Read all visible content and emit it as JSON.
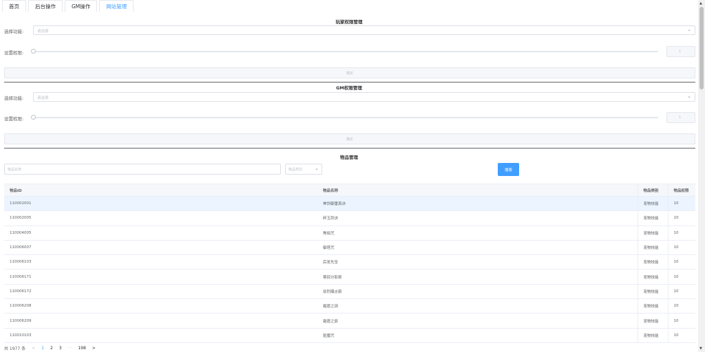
{
  "tabs": [
    {
      "label": "首页",
      "active": false
    },
    {
      "label": "后台操作",
      "active": false
    },
    {
      "label": "GM操作",
      "active": false
    },
    {
      "label": "网站管理",
      "active": true
    }
  ],
  "player_permission": {
    "title": "玩家权限管理",
    "function_label": "选择功能:",
    "function_placeholder": "请选择",
    "permission_label": "设置权限:",
    "permission_value": "1",
    "confirm_label": "确定"
  },
  "gm_permission": {
    "title": "GM权限管理",
    "function_label": "选择功能:",
    "function_placeholder": "请选择",
    "permission_label": "设置权限:",
    "permission_value": "1",
    "confirm_label": "确定"
  },
  "items": {
    "title": "物品管理",
    "name_placeholder": "物品名称",
    "category_placeholder": "物品类别",
    "search_label": "搜索",
    "columns": [
      "物品ID",
      "物品名称",
      "物品类别",
      "物品权限"
    ],
    "rows": [
      {
        "id": "110002001",
        "name": "神剑御雷真诀",
        "category": "宠物技能",
        "permission": "10"
      },
      {
        "id": "110002005",
        "name": "碎玉剑诀",
        "category": "宠物技能",
        "permission": "10"
      },
      {
        "id": "110004005",
        "name": "焦焰咒",
        "category": "宠物技能",
        "permission": "10"
      },
      {
        "id": "110006007",
        "name": "御塔咒",
        "category": "宠物技能",
        "permission": "10"
      },
      {
        "id": "110006103",
        "name": "后发先至",
        "category": "宠物技能",
        "permission": "10"
      },
      {
        "id": "110006171",
        "name": "寒掠分影箭",
        "category": "宠物技能",
        "permission": "10"
      },
      {
        "id": "110006172",
        "name": "劲烈爆炎箭",
        "category": "宠物技能",
        "permission": "10"
      },
      {
        "id": "110006208",
        "name": "霜霆之阔",
        "category": "宠物技能",
        "permission": "10"
      },
      {
        "id": "110006209",
        "name": "霜霆之辰",
        "category": "宠物技能",
        "permission": "10"
      },
      {
        "id": "110010103",
        "name": "驱魔咒",
        "category": "宠物技能",
        "permission": "10"
      }
    ]
  },
  "pagination": {
    "total": "共 1977 条",
    "prev": "<",
    "pages": [
      "1",
      "2",
      "3"
    ],
    "ellipsis": "···",
    "last": "198",
    "next": ">"
  },
  "icons": {
    "chevron": "chevron-down-icon",
    "scroll_up": "scroll-up-icon",
    "scroll_down": "scroll-down-icon"
  },
  "colors": {
    "accent": "#409eff",
    "row_highlight": "#ecf5ff",
    "border": "#dcdfe6"
  }
}
